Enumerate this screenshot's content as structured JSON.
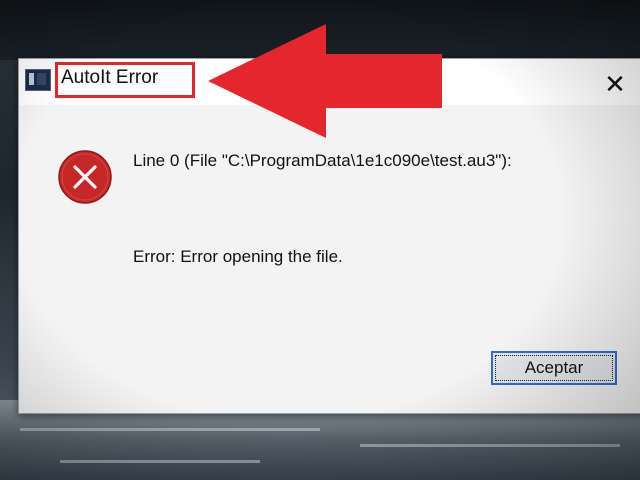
{
  "window": {
    "title": "AutoIt Error",
    "close_symbol": "✕"
  },
  "dialog": {
    "line1": "Line 0  (File \"C:\\ProgramData\\1e1c090e\\test.au3\"):",
    "line2": "Error: Error opening the file.",
    "ok_label": "Aceptar"
  },
  "icons": {
    "error": "error-icon",
    "app": "autoit-app-icon",
    "annotation": "red-arrow-annotation"
  },
  "colors": {
    "annotation_red": "#e5262f",
    "error_icon_red": "#c62828",
    "focus_blue": "#2f6dd0"
  }
}
